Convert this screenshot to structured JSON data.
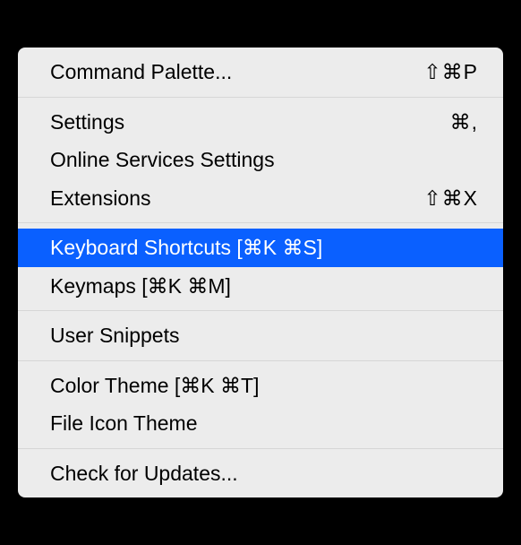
{
  "menu": {
    "groups": [
      [
        {
          "id": "command-palette",
          "label": "Command Palette...",
          "shortcut": "⇧⌘P",
          "selected": false
        }
      ],
      [
        {
          "id": "settings",
          "label": "Settings",
          "shortcut": "⌘,",
          "selected": false
        },
        {
          "id": "online-services-settings",
          "label": "Online Services Settings",
          "shortcut": "",
          "selected": false
        },
        {
          "id": "extensions",
          "label": "Extensions",
          "shortcut": "⇧⌘X",
          "selected": false
        }
      ],
      [
        {
          "id": "keyboard-shortcuts",
          "label": "Keyboard Shortcuts [⌘K ⌘S]",
          "shortcut": "",
          "selected": true
        },
        {
          "id": "keymaps",
          "label": "Keymaps [⌘K ⌘M]",
          "shortcut": "",
          "selected": false
        }
      ],
      [
        {
          "id": "user-snippets",
          "label": "User Snippets",
          "shortcut": "",
          "selected": false
        }
      ],
      [
        {
          "id": "color-theme",
          "label": "Color Theme [⌘K ⌘T]",
          "shortcut": "",
          "selected": false
        },
        {
          "id": "file-icon-theme",
          "label": "File Icon Theme",
          "shortcut": "",
          "selected": false
        }
      ],
      [
        {
          "id": "check-for-updates",
          "label": "Check for Updates...",
          "shortcut": "",
          "selected": false
        }
      ]
    ]
  }
}
